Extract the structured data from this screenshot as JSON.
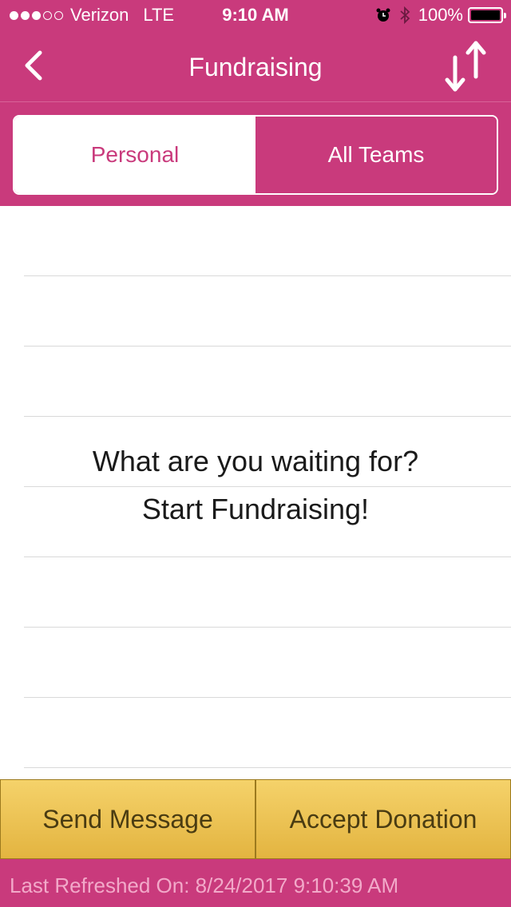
{
  "status_bar": {
    "signal_icon": "signal-dots-icon",
    "carrier": "Verizon",
    "network": "LTE",
    "time": "9:10 AM",
    "alarm_icon": "alarm-icon",
    "bluetooth_icon": "bluetooth-icon",
    "battery_percent": "100%",
    "battery_icon": "battery-icon"
  },
  "nav": {
    "back_icon": "chevron-left-icon",
    "title": "Fundraising",
    "sort_icon": "sort-arrows-icon"
  },
  "tabs": {
    "personal": "Personal",
    "all_teams": "All Teams",
    "selected": "Personal"
  },
  "empty_state": {
    "line1": "What are you waiting for?",
    "line2": "Start Fundraising!"
  },
  "actions": {
    "send_message": "Send Message",
    "accept_donation": "Accept Donation"
  },
  "footer": {
    "last_refreshed": "Last Refreshed On: 8/24/2017 9:10:39 AM"
  },
  "colors": {
    "brand_pink": "#c93a7c",
    "button_gold": "#e9c050",
    "footer_text": "#f2a9c9"
  }
}
